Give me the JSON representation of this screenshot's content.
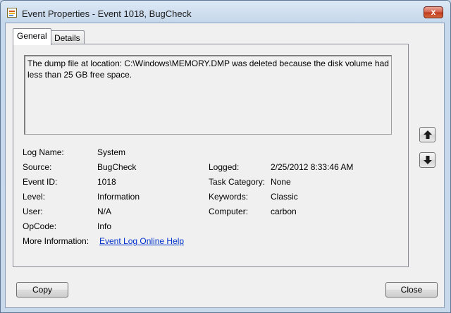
{
  "window": {
    "title": "Event Properties - Event 1018, BugCheck",
    "close_glyph": "x"
  },
  "tabs": [
    {
      "label": "General",
      "selected": true
    },
    {
      "label": "Details",
      "selected": false
    }
  ],
  "description": "The dump file at location: C:\\Windows\\MEMORY.DMP was deleted because the disk volume had less than 25 GB free space.",
  "fields": {
    "log_name": {
      "label": "Log Name:",
      "value": "System"
    },
    "source": {
      "label": "Source:",
      "value": "BugCheck"
    },
    "event_id": {
      "label": "Event ID:",
      "value": "1018"
    },
    "level": {
      "label": "Level:",
      "value": "Information"
    },
    "user": {
      "label": "User:",
      "value": "N/A"
    },
    "opcode": {
      "label": "OpCode:",
      "value": "Info"
    },
    "more_info": {
      "label": "More Information:",
      "value": "Event Log Online Help"
    },
    "logged": {
      "label": "Logged:",
      "value": "2/25/2012 8:33:46 AM"
    },
    "task_category": {
      "label": "Task Category:",
      "value": "None"
    },
    "keywords": {
      "label": "Keywords:",
      "value": "Classic"
    },
    "computer": {
      "label": "Computer:",
      "value": "carbon"
    }
  },
  "buttons": {
    "copy": "Copy",
    "close": "Close"
  },
  "nav": {
    "up_icon": "arrow-up-icon",
    "down_icon": "arrow-down-icon"
  },
  "colors": {
    "link": "#0033cc",
    "close_button": "#c0381c"
  }
}
